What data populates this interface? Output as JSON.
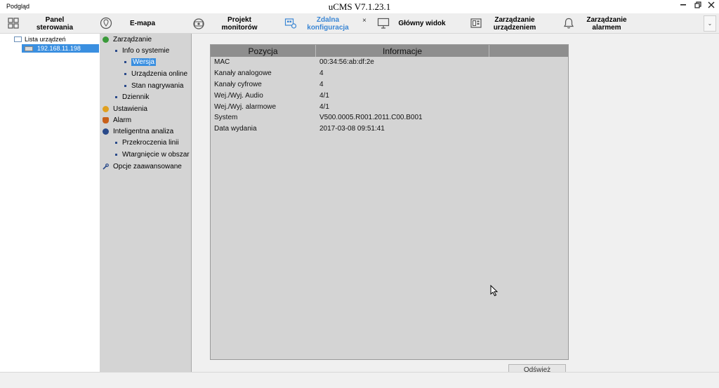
{
  "titlebar": {
    "left_label": "Podgląd",
    "app_title": "uCMS V7.1.23.1"
  },
  "nav": {
    "items": [
      {
        "label_line1": "Panel",
        "label_line2": "sterowania"
      },
      {
        "label_line1": "E-mapa",
        "label_line2": ""
      },
      {
        "label_line1": "Projekt",
        "label_line2": "monitorów"
      },
      {
        "label_line1": "Zdalna",
        "label_line2": "konfiguracja"
      },
      {
        "label_line1": "Główny widok",
        "label_line2": ""
      },
      {
        "label_line1": "Zarządzanie",
        "label_line2": "urządzeniem"
      },
      {
        "label_line1": "Zarządzanie",
        "label_line2": "alarmem"
      }
    ],
    "close_glyph": "×",
    "dropdown_glyph": "⌄",
    "accent_color": "#3a86d4"
  },
  "device_list": {
    "root_label": "Lista urządzeń",
    "device_ip": "192.168.11.198"
  },
  "menu": {
    "items": [
      {
        "label": "Zarządzanie"
      },
      {
        "label": "Info o systemie"
      },
      {
        "label": "Wersja"
      },
      {
        "label": "Urządzenia online"
      },
      {
        "label": "Stan nagrywania"
      },
      {
        "label": "Dziennik"
      },
      {
        "label": "Ustawienia"
      },
      {
        "label": "Alarm"
      },
      {
        "label": "Inteligentna analiza"
      },
      {
        "label": "Przekroczenia linii"
      },
      {
        "label": "Wtargnięcie w obszar"
      },
      {
        "label": "Opcje zaawansowane"
      }
    ]
  },
  "table": {
    "headers": [
      "Pozycja",
      "Informacje"
    ],
    "rows": [
      {
        "key": "MAC",
        "value": "00:34:56:ab:df:2e"
      },
      {
        "key": "Kanały analogowe",
        "value": "4"
      },
      {
        "key": "Kanały cyfrowe",
        "value": "4"
      },
      {
        "key": "Wej./Wyj. Audio",
        "value": "4/1"
      },
      {
        "key": "Wej./Wyj. alarmowe",
        "value": "4/1"
      },
      {
        "key": "System",
        "value": "V500.0005.R001.2011.C00.B001"
      },
      {
        "key": "Data wydania",
        "value": "2017-03-08 09:51:41"
      }
    ]
  },
  "refresh_button": {
    "label": "Odśwież"
  }
}
